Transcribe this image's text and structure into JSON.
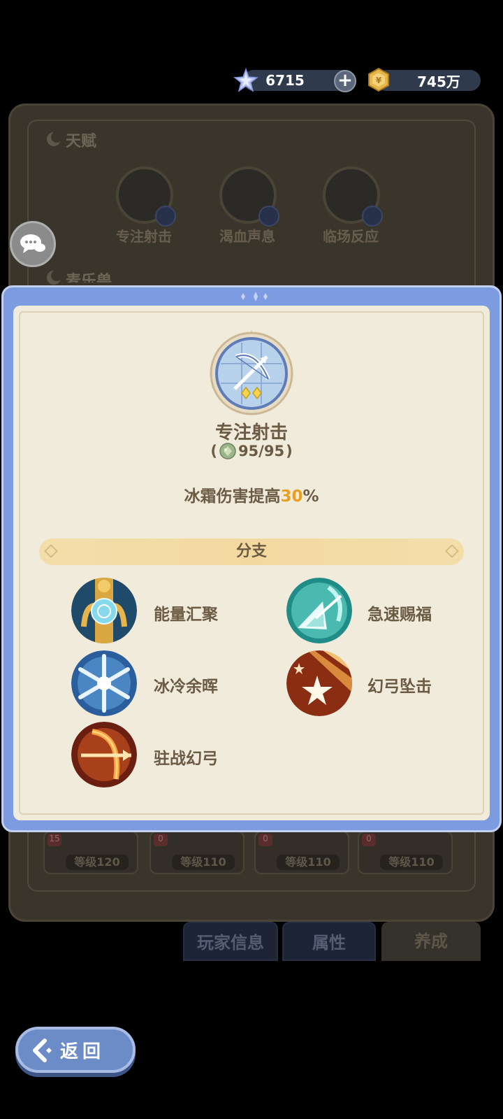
{
  "currency": {
    "gems": "6715",
    "coins": "745万"
  },
  "background": {
    "talent_section_title": "天赋",
    "talents": [
      {
        "label": "专注射击"
      },
      {
        "label": "渴血声息"
      },
      {
        "label": "临场反应"
      }
    ],
    "pet_section_title": "麦乐兽",
    "pets": [
      {
        "badge": "15",
        "level": "等级120"
      },
      {
        "badge": "0",
        "level": "等级110"
      },
      {
        "badge": "0",
        "level": "等级110"
      },
      {
        "badge": "0",
        "level": "等级110"
      }
    ],
    "tabs": [
      {
        "label": "玩家信息"
      },
      {
        "label": "属性"
      },
      {
        "label": "养成"
      }
    ]
  },
  "modal": {
    "talent_name": "专注射击",
    "cost_open": "(",
    "cost": "95/95",
    "cost_close": ")",
    "desc_prefix": "冰霜伤害提高",
    "desc_value": "30",
    "desc_suffix": "%",
    "branch_title": "分支",
    "branches": [
      {
        "label": "能量汇聚",
        "icon": "energy-gather-icon"
      },
      {
        "label": "急速赐福",
        "icon": "swift-blessing-icon"
      },
      {
        "label": "冰冷余晖",
        "icon": "frost-afterglow-icon"
      },
      {
        "label": "幻弓坠击",
        "icon": "phantom-bow-strike-icon"
      },
      {
        "label": "驻战幻弓",
        "icon": "stationed-phantom-bow-icon"
      }
    ]
  },
  "back_button": {
    "label": "返回"
  },
  "colors": {
    "accent": "#e9a020",
    "modal_border": "#7d9be0",
    "text_brown": "#6b5b45"
  }
}
